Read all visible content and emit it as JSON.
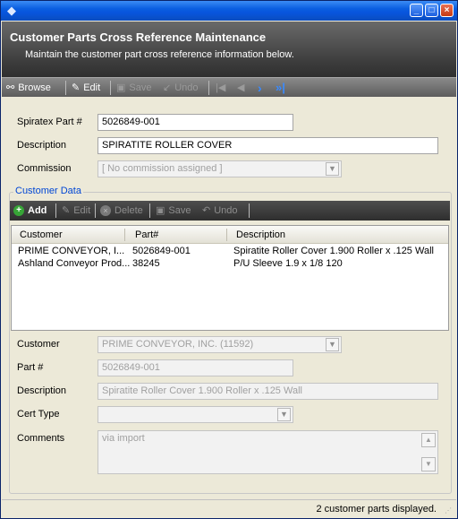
{
  "window": {
    "icon": "app-diamond-icon"
  },
  "header": {
    "title": "Customer Parts Cross Reference Maintenance",
    "subtitle": "Maintain the customer part cross reference information below."
  },
  "toolbar": {
    "browse": "Browse",
    "edit": "Edit",
    "save": "Save",
    "undo": "Undo"
  },
  "part": {
    "spiratex_label": "Spiratex Part #",
    "spiratex_value": "5026849-001",
    "description_label": "Description",
    "description_value": "SPIRATITE ROLLER COVER",
    "commission_label": "Commission",
    "commission_value": "[ No commission assigned ]"
  },
  "customer_data": {
    "group_title": "Customer Data",
    "toolbar": {
      "add": "Add",
      "edit": "Edit",
      "delete": "Delete",
      "save": "Save",
      "undo": "Undo"
    },
    "columns": [
      "Customer",
      "Part#",
      "Description"
    ],
    "rows": [
      {
        "customer": "PRIME CONVEYOR, I...",
        "part": "5026849-001",
        "description": "Spiratite Roller Cover 1.900 Roller x .125 Wall"
      },
      {
        "customer": "Ashland Conveyor Prod...",
        "part": "38245",
        "description": "P/U Sleeve 1.9 x 1/8 120"
      }
    ]
  },
  "detail": {
    "customer_label": "Customer",
    "customer_value": "PRIME CONVEYOR, INC. (11592)",
    "part_label": "Part #",
    "part_value": "5026849-001",
    "description_label": "Description",
    "description_value": "Spiratite Roller Cover 1.900 Roller x .125 Wall",
    "cert_type_label": "Cert Type",
    "cert_type_value": "",
    "comments_label": "Comments",
    "comments_value": "via import"
  },
  "status": {
    "text": "2 customer parts displayed."
  }
}
